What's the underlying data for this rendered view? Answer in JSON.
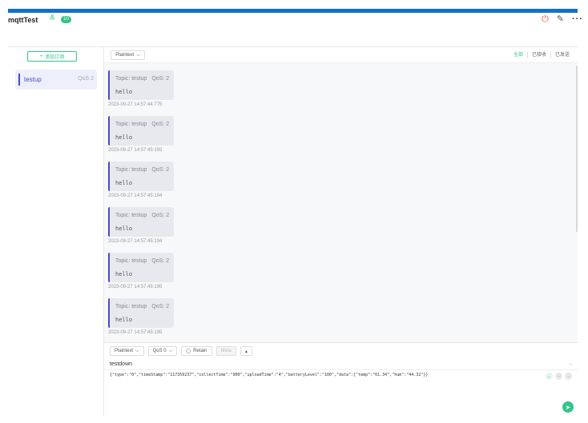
{
  "header": {
    "connection_name": "mqttTest",
    "chevron_icon": "chevron-double-down-icon",
    "badge": "10",
    "icons": [
      "power-icon",
      "edit-icon",
      "more-icon"
    ]
  },
  "sidebar": {
    "add_subscription_label": "添加订阅",
    "subscriptions": [
      {
        "topic": "testup",
        "qos": "QoS 2",
        "color": "#4a4bc8"
      }
    ]
  },
  "toolbar": {
    "format": "Plaintext",
    "filters": [
      "全部",
      "已接收",
      "已发送"
    ]
  },
  "messages": [
    {
      "topic_label": "Topic: testup",
      "qos": "QoS: 2",
      "payload": "hello",
      "time": "2023-09-27 14:57:44:775"
    },
    {
      "topic_label": "Topic: testup",
      "qos": "QoS: 2",
      "payload": "hello",
      "time": "2023-09-27 14:57:45:193"
    },
    {
      "topic_label": "Topic: testup",
      "qos": "QoS: 2",
      "payload": "hello",
      "time": "2023-09-27 14:57:45:194"
    },
    {
      "topic_label": "Topic: testup",
      "qos": "QoS: 2",
      "payload": "hello",
      "time": "2023-09-27 14:57:45:194"
    },
    {
      "topic_label": "Topic: testup",
      "qos": "QoS: 2",
      "payload": "hello",
      "time": "2023-09-27 14:57:45:195"
    },
    {
      "topic_label": "Topic: testup",
      "qos": "QoS: 2",
      "payload": "hello",
      "time": "2023-09-27 14:57:45:195"
    }
  ],
  "publisher": {
    "format": "Plaintext",
    "qos": "QoS 0",
    "retain_label": "Retain",
    "meta_label": "Meta",
    "topic": "testdown",
    "payload": "{\"type\":\"0\",\"timeStamp\":\"117359237\",\"collectTime\":\"900\",\"uploadTime\":\"4\",\"batteryLevel\":\"100\",\"data\":{\"temp\":\"61.34\",\"hum\":\"44.32\"}}"
  },
  "colors": {
    "accent": "#34c388",
    "brand_bar": "#1270c8",
    "topic_color": "#4a4bc8",
    "power": "#e94e3a"
  }
}
